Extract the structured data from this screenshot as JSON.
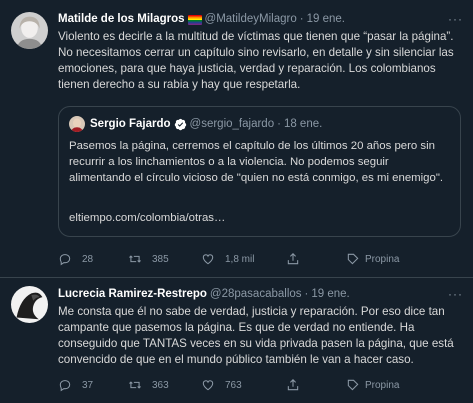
{
  "tweets": [
    {
      "name": "Matilde de los Milagros",
      "handle": "@MatildeyMilagro",
      "separator": "·",
      "date": "19 ene.",
      "more": "···",
      "text": "Violento es decirle a la multitud de víctimas que tienen que “pasar la página”. No necesitamos cerrar un capítulo sino revisarlo, en detalle y sin silenciar las emociones, para que haya justicia, verdad y reparación. Los colombianos tienen derecho a su rabia y hay que respetarla.",
      "quote": {
        "name": "Sergio Fajardo",
        "handle": "@sergio_fajardo",
        "separator": "·",
        "date": "18 ene.",
        "text": "Pasemos la página, cerremos el capítulo de los últimos 20 años pero sin recurrir a los linchamientos o a la violencia. No podemos seguir alimentando el círculo vicioso de \"quien no está conmigo, es mi enemigo\".",
        "link": "eltiempo.com/colombia/otras…"
      },
      "actions": {
        "replies": "28",
        "retweets": "385",
        "likes": "1,8 mil",
        "promote": "Propina"
      }
    },
    {
      "name": "Lucrecia Ramirez-Restrepo",
      "handle": "@28pasacaballos",
      "separator": "·",
      "date": "19 ene.",
      "more": "···",
      "text": "Me consta que él no sabe de verdad, justicia y reparación. Por eso dice tan campante que pasemos la página. Es que de verdad no entiende. Ha conseguido que TANTAS veces en su vida privada pasen la página, que está convencido de que en el mundo público también le van a hacer caso.",
      "actions": {
        "replies": "37",
        "retweets": "363",
        "likes": "763",
        "promote": "Propina"
      }
    }
  ]
}
